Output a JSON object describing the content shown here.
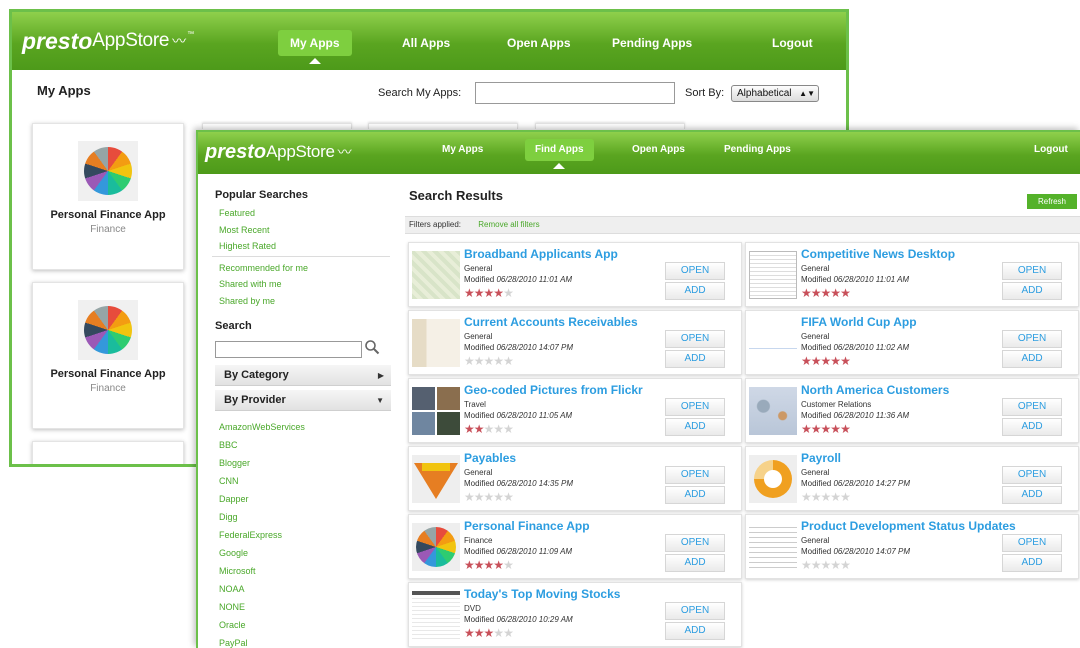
{
  "back": {
    "logo": {
      "presto": "presto",
      "app": "AppStore",
      "tm": "™"
    },
    "nav": [
      {
        "label": "My Apps",
        "active": true
      },
      {
        "label": "All Apps",
        "active": false
      },
      {
        "label": "Open Apps",
        "active": false
      },
      {
        "label": "Pending Apps",
        "active": false
      },
      {
        "label": "Logout",
        "active": false
      }
    ],
    "page_title": "My Apps",
    "search_label": "Search My Apps:",
    "sort_label": "Sort By:",
    "sort_value": "Alphabetical",
    "cards": [
      {
        "name": "Personal Finance App",
        "category": "Finance"
      },
      {
        "name": "Personal Finance App",
        "category": "Finance"
      }
    ]
  },
  "front": {
    "logo": {
      "presto": "presto",
      "app": "AppStore"
    },
    "nav": [
      {
        "label": "My Apps",
        "active": false
      },
      {
        "label": "Find Apps",
        "active": true
      },
      {
        "label": "Open Apps",
        "active": false
      },
      {
        "label": "Pending Apps",
        "active": false
      },
      {
        "label": "Logout",
        "active": false
      }
    ],
    "sidebar": {
      "popular_title": "Popular Searches",
      "popular": [
        "Featured",
        "Most Recent",
        "Highest Rated"
      ],
      "social": [
        "Recommended for me",
        "Shared with me",
        "Shared by me"
      ],
      "search_title": "Search",
      "by_category": "By Category",
      "by_provider": "By Provider",
      "providers": [
        "AmazonWebServices",
        "BBC",
        "Blogger",
        "CNN",
        "Dapper",
        "Digg",
        "FederalExpress",
        "Google",
        "Microsoft",
        "NOAA",
        "NONE",
        "Oracle",
        "PayPal"
      ]
    },
    "main": {
      "title": "Search Results",
      "refresh": "Refresh",
      "filters_label": "Filters applied:",
      "remove_filters": "Remove all filters",
      "open_label": "OPEN",
      "add_label": "ADD",
      "modified_prefix": "Modified",
      "apps": [
        {
          "name": "Broadband Applicants App",
          "category": "General",
          "modified": "06/28/2010 11:01 AM",
          "rating": 4,
          "thumb": "map"
        },
        {
          "name": "Competitive News Desktop",
          "category": "General",
          "modified": "06/28/2010 11:01 AM",
          "rating": 5,
          "thumb": "desk"
        },
        {
          "name": "Current Accounts Receivables",
          "category": "General",
          "modified": "06/28/2010 14:07 PM",
          "rating": 0,
          "thumb": "doc"
        },
        {
          "name": "FIFA World Cup App",
          "category": "General",
          "modified": "06/28/2010 11:02 AM",
          "rating": 5,
          "thumb": "chart"
        },
        {
          "name": "Geo-coded Pictures from Flickr",
          "category": "Travel",
          "modified": "06/28/2010 11:05 AM",
          "rating": 2,
          "thumb": "photo"
        },
        {
          "name": "North America Customers",
          "category": "Customer Relations",
          "modified": "06/28/2010 11:36 AM",
          "rating": 5,
          "thumb": "map2"
        },
        {
          "name": "Payables",
          "category": "General",
          "modified": "06/28/2010 14:35 PM",
          "rating": 0,
          "thumb": "funnel"
        },
        {
          "name": "Payroll",
          "category": "General",
          "modified": "06/28/2010 14:27 PM",
          "rating": 0,
          "thumb": "ring"
        },
        {
          "name": "Personal Finance App",
          "category": "Finance",
          "modified": "06/28/2010 11:09 AM",
          "rating": 4,
          "thumb": "pie"
        },
        {
          "name": "Product Development Status Updates",
          "category": "General",
          "modified": "06/28/2010 14:07 PM",
          "rating": 0,
          "thumb": "slice"
        },
        {
          "name": "Today's Top Moving Stocks",
          "category": "DVD",
          "modified": "06/28/2010 10:29 AM",
          "rating": 3,
          "thumb": "table"
        }
      ]
    }
  },
  "colors": {
    "header_green": "#5aa520",
    "active_tab": "#7ecf3f",
    "link_green": "#4aa82a",
    "title_blue": "#2c9de0",
    "star_red": "#c8505a"
  }
}
